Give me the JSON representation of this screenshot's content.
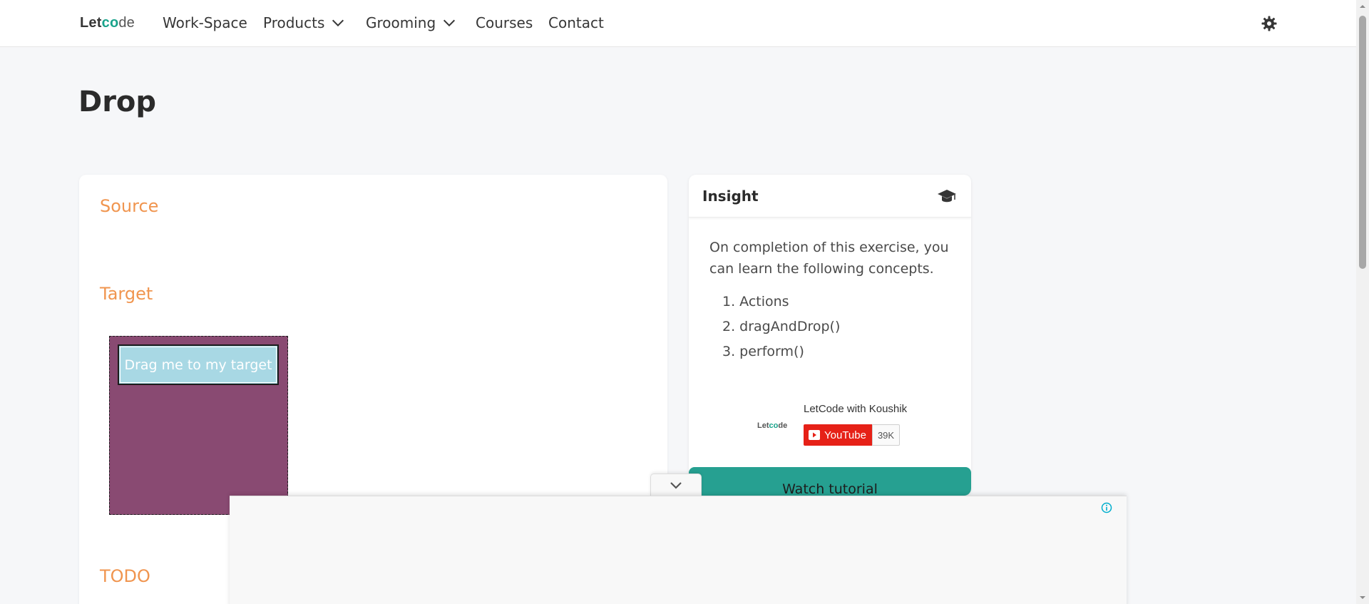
{
  "nav": {
    "logo": {
      "part1": "Let",
      "part2": "c",
      "part3": "o",
      "part4": "de"
    },
    "items": [
      {
        "label": "Work-Space",
        "has_dropdown": false
      },
      {
        "label": "Products",
        "has_dropdown": true
      },
      {
        "label": "Grooming",
        "has_dropdown": true
      },
      {
        "label": "Courses",
        "has_dropdown": false
      },
      {
        "label": "Contact",
        "has_dropdown": false
      }
    ],
    "theme_icon": "gear-icon"
  },
  "page": {
    "title": "Drop"
  },
  "main": {
    "source_label": "Source",
    "target_label": "Target",
    "todo_label": "TODO",
    "draggable_text": "Drag me to my target",
    "target_color": "#894a72",
    "draggable_color": "#a8d8e4",
    "label_color": "#f0954f"
  },
  "insight": {
    "title": "Insight",
    "icon": "graduation-cap-icon",
    "description": "On completion of this exercise, you can learn the following concepts.",
    "concepts": [
      "1. Actions",
      "2. dragAndDrop()",
      "3. perform()"
    ],
    "youtube": {
      "logo": {
        "part1": "Let",
        "part2": "c",
        "part3": "o",
        "part4": "de"
      },
      "channel": "LetCode with Koushik",
      "button_label": "YouTube",
      "subscriber_count": "39K"
    },
    "watch_button": "Watch tutorial",
    "accent_color": "#26a091"
  },
  "ad": {
    "collapse_icon": "chevron-down-icon",
    "info_icon": "info-icon"
  }
}
